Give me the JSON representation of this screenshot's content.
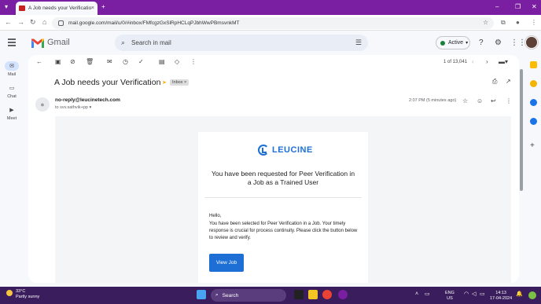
{
  "browser": {
    "tab_title": "A Job needs your Verification - ",
    "url": "mail.google.com/mail/u/0/#inbox/FMfcgzGxSlRpHCLqPJbhWwPBmsvnkMT"
  },
  "gmail": {
    "logo_text": "Gmail",
    "search_placeholder": "Search in mail",
    "status_label": "Active"
  },
  "rail": {
    "mail_label": "Mail",
    "chat_label": "Chat",
    "meet_label": "Meet"
  },
  "toolbar": {
    "counter": "1 of 13,041"
  },
  "message": {
    "subject": "A Job needs your Verification",
    "label_chip": "Inbox ×",
    "sender": "no-reply@leucinetech.com",
    "to": "to svv.sathvik+pp ▾",
    "time": "2:07 PM (5 minutes ago)"
  },
  "email": {
    "brand": "LEUCINE",
    "headline": "You have been requested for Peer Verification in a Job as a Trained User",
    "greeting": "Hello,",
    "body": "You have been selected for Peer Verification in a Job. Your timely response is crucial for process continuity. Please click the button below to review and verify.",
    "button_label": "View Job"
  },
  "taskbar": {
    "temperature": "33°C",
    "weather_desc": "Partly sunny",
    "search_label": "Search",
    "lang": "ENG",
    "region": "US",
    "time": "14:13",
    "date": "17-04-2024"
  },
  "colors": {
    "accent": "#1d6fd6",
    "chrome_purple": "#7b1fa2",
    "taskbar": "#3a1d5c"
  }
}
